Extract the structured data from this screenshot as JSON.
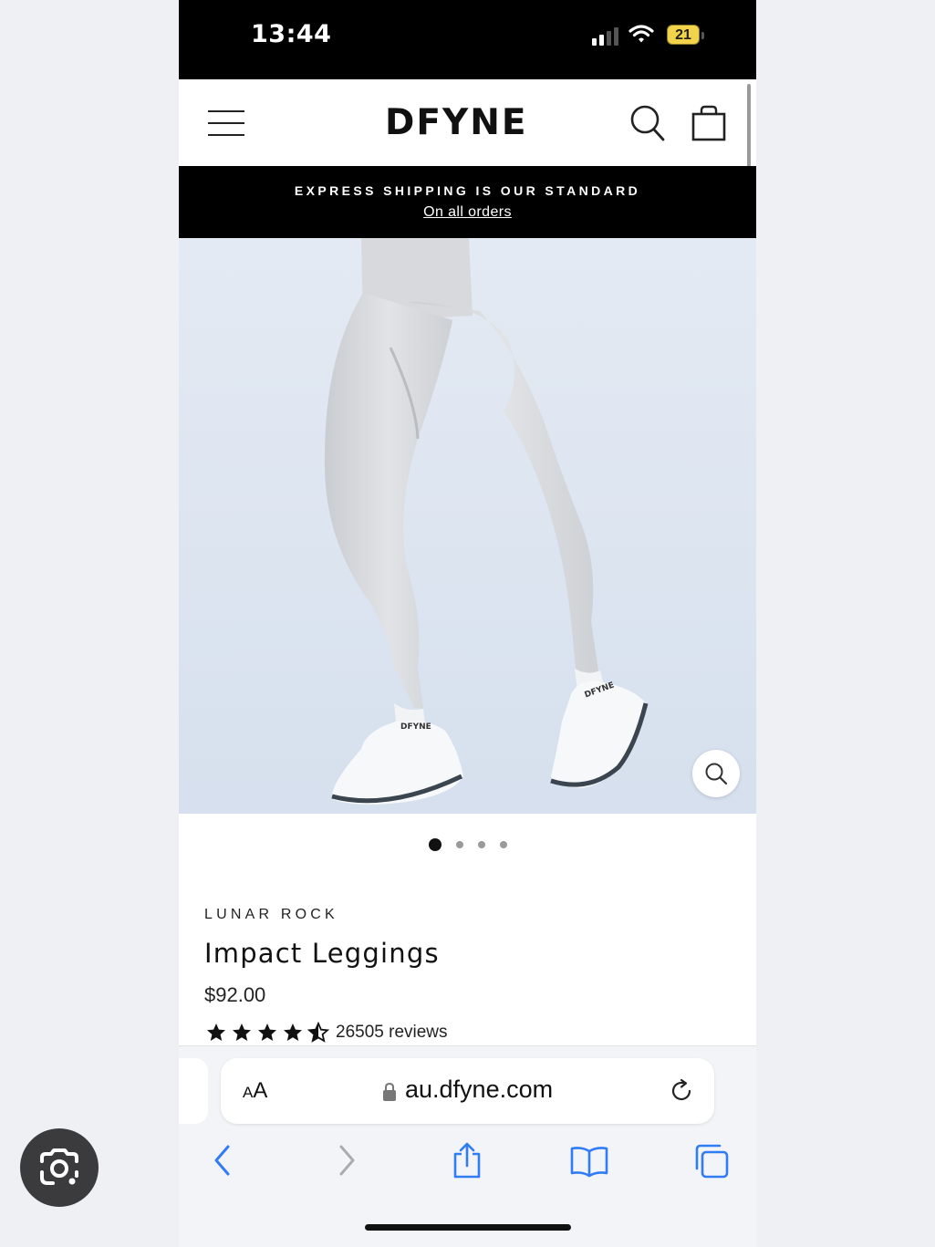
{
  "status_bar": {
    "time": "13:44",
    "battery": "21"
  },
  "header": {
    "logo": "DFYNE"
  },
  "promo": {
    "title": "EXPRESS SHIPPING IS OUR STANDARD",
    "link": "On all orders"
  },
  "gallery": {
    "total_images": 4,
    "active_index": 0
  },
  "product": {
    "variant": "LUNAR ROCK",
    "title": "Impact Leggings",
    "price": "$92.00",
    "rating": 4.5,
    "reviews": "26505 reviews"
  },
  "browser": {
    "text_size_label": "AA",
    "url": "au.dfyne.com"
  },
  "colors": {
    "accent": "#000000",
    "legging": "#d9dbde",
    "background": "#dfe6f1"
  }
}
